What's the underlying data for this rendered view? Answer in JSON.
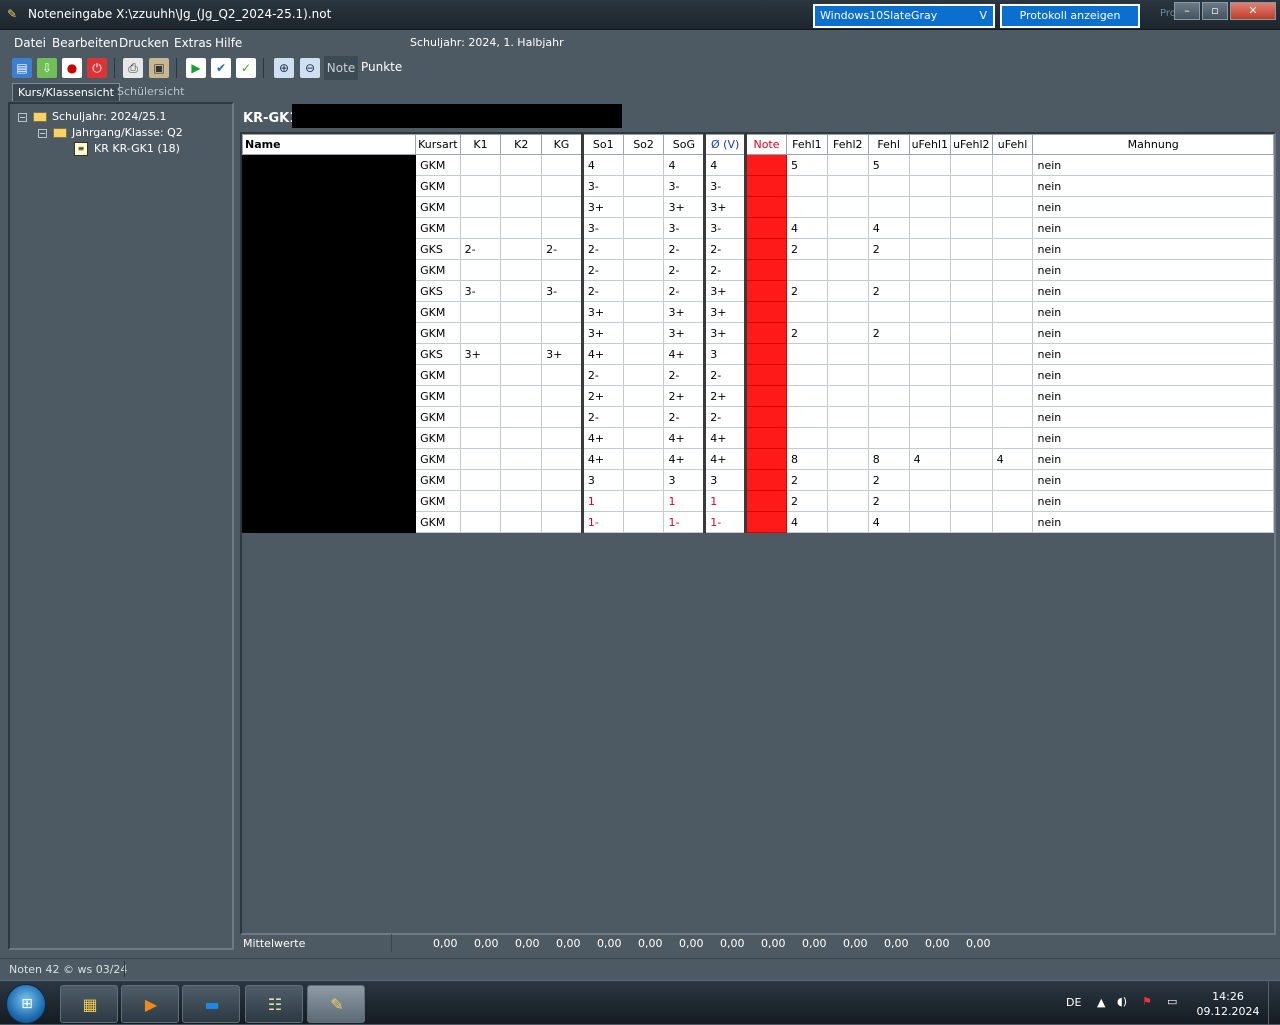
{
  "window": {
    "title": "Noteneingabe X:\\zzuuhh\\Jg_(Jg_Q2_2024-25.1).not",
    "theme_select": "Windows10SlateGray",
    "theme_arrow": "V",
    "protocol_button": "Protokoll anzeigen",
    "ghost_text": "Pro"
  },
  "menu": {
    "items": [
      "Datei",
      "Bearbeiten",
      "Drucken",
      "Extras",
      "Hilfe"
    ],
    "status": "Schuljahr: 2024, 1. Halbjahr"
  },
  "toolbar": {
    "mode_note": "Note",
    "mode_punkte": "Punkte",
    "icons": [
      "save-icon",
      "import-icon",
      "export-icon",
      "power-icon",
      "print-icon",
      "print-preview-icon",
      "play-icon",
      "check-blue-icon",
      "check-green-icon",
      "zoom-in-icon",
      "zoom-out-icon"
    ]
  },
  "tabs": [
    "Kurs/Klassensicht",
    "Schülersicht"
  ],
  "tree": {
    "root": "Schuljahr: 2024/25.1",
    "child": "Jahrgang/Klasse: Q2",
    "leaf": "KR KR-GK1 (18)"
  },
  "course": {
    "label": "KR-GK1"
  },
  "table": {
    "headers": [
      "Name",
      "Kursart",
      "K1",
      "K2",
      "KG",
      "So1",
      "So2",
      "SoG",
      "Ø (V)",
      "Note",
      "Fehl1",
      "Fehl2",
      "Fehl",
      "uFehl1",
      "uFehl2",
      "uFehl",
      "Mahnung"
    ],
    "rows": [
      [
        "GKM",
        "",
        "",
        "",
        "4",
        "",
        "4",
        "4",
        "",
        "5",
        "",
        "5",
        "",
        "",
        "",
        "nein"
      ],
      [
        "GKM",
        "",
        "",
        "",
        "3-",
        "",
        "3-",
        "3-",
        "",
        "",
        "",
        "",
        "",
        "",
        "",
        "nein"
      ],
      [
        "GKM",
        "",
        "",
        "",
        "3+",
        "",
        "3+",
        "3+",
        "",
        "",
        "",
        "",
        "",
        "",
        "",
        "nein"
      ],
      [
        "GKM",
        "",
        "",
        "",
        "3-",
        "",
        "3-",
        "3-",
        "",
        "4",
        "",
        "4",
        "",
        "",
        "",
        "nein"
      ],
      [
        "GKS",
        "2-",
        "",
        "2-",
        "2-",
        "",
        "2-",
        "2-",
        "",
        "2",
        "",
        "2",
        "",
        "",
        "",
        "nein"
      ],
      [
        "GKM",
        "",
        "",
        "",
        "2-",
        "",
        "2-",
        "2-",
        "",
        "",
        "",
        "",
        "",
        "",
        "",
        "nein"
      ],
      [
        "GKS",
        "3-",
        "",
        "3-",
        "2-",
        "",
        "2-",
        "3+",
        "",
        "2",
        "",
        "2",
        "",
        "",
        "",
        "nein"
      ],
      [
        "GKM",
        "",
        "",
        "",
        "3+",
        "",
        "3+",
        "3+",
        "",
        "",
        "",
        "",
        "",
        "",
        "",
        "nein"
      ],
      [
        "GKM",
        "",
        "",
        "",
        "3+",
        "",
        "3+",
        "3+",
        "",
        "2",
        "",
        "2",
        "",
        "",
        "",
        "nein"
      ],
      [
        "GKS",
        "3+",
        "",
        "3+",
        "4+",
        "",
        "4+",
        "3",
        "",
        "",
        "",
        "",
        "",
        "",
        "",
        "nein"
      ],
      [
        "GKM",
        "",
        "",
        "",
        "2-",
        "",
        "2-",
        "2-",
        "",
        "",
        "",
        "",
        "",
        "",
        "",
        "nein"
      ],
      [
        "GKM",
        "",
        "",
        "",
        "2+",
        "",
        "2+",
        "2+",
        "",
        "",
        "",
        "",
        "",
        "",
        "",
        "nein"
      ],
      [
        "GKM",
        "",
        "",
        "",
        "2-",
        "",
        "2-",
        "2-",
        "",
        "",
        "",
        "",
        "",
        "",
        "",
        "nein"
      ],
      [
        "GKM",
        "",
        "",
        "",
        "4+",
        "",
        "4+",
        "4+",
        "",
        "",
        "",
        "",
        "",
        "",
        "",
        "nein"
      ],
      [
        "GKM",
        "",
        "",
        "",
        "4+",
        "",
        "4+",
        "4+",
        "",
        "8",
        "",
        "8",
        "4",
        "",
        "4",
        "nein"
      ],
      [
        "GKM",
        "",
        "",
        "",
        "3",
        "",
        "3",
        "3",
        "",
        "2",
        "",
        "2",
        "",
        "",
        "",
        "nein"
      ],
      [
        "GKM",
        "",
        "",
        "",
        "1",
        "",
        "1",
        "1",
        "",
        "2",
        "",
        "2",
        "",
        "",
        "",
        "nein"
      ],
      [
        "GKM",
        "",
        "",
        "",
        "1-",
        "",
        "1-",
        "1-",
        "",
        "4",
        "",
        "4",
        "",
        "",
        "",
        "nein"
      ]
    ],
    "red_rows": [
      16,
      17
    ]
  },
  "footer": {
    "label": "Mittelwerte",
    "values": [
      "0,00",
      "0,00",
      "0,00",
      "0,00",
      "0,00",
      "0,00",
      "0,00",
      "0,00",
      "0,00",
      "0,00",
      "0,00",
      "0,00",
      "0,00",
      "0,00"
    ]
  },
  "statusbar": {
    "text": "Noten 42 © ws 03/24"
  },
  "taskbar": {
    "lang": "DE",
    "time": "14:26",
    "date": "09.12.2024",
    "apps": [
      "explorer-icon",
      "media-player-icon",
      "terminal-icon",
      "spreadsheet-icon",
      "noten-app-icon"
    ]
  }
}
